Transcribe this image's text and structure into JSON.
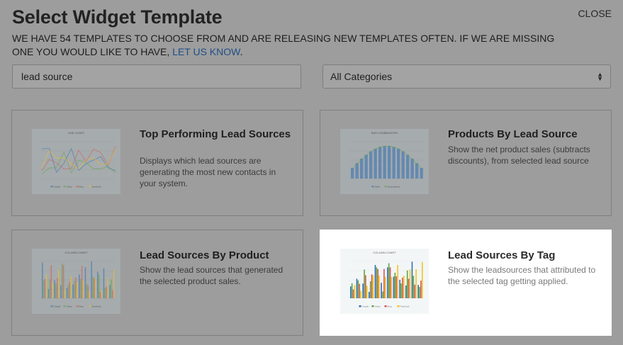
{
  "header": {
    "title": "Select Widget Template",
    "close_label": "CLOSE",
    "description_prefix": "We have 54 templates to choose from and are releasing new templates often. If we are missing one you would like to have, ",
    "link_label": "Let us know",
    "description_suffix": "."
  },
  "filters": {
    "search_value": "lead source",
    "category_selected": "All Categories"
  },
  "cards": [
    {
      "title": "Top Performing Lead Sources",
      "description": "Displays which lead sources are generating the most new contacts in your system.",
      "selected": false,
      "thumb": {
        "type": "line",
        "title": "LINE CHART",
        "legend": [
          "Google",
          "Yahoo",
          "Bing",
          "Facebook"
        ]
      }
    },
    {
      "title": "Products By Lead Source",
      "description": "Show the net product sales (subtracts discounts), from selected lead source",
      "selected": false,
      "thumb": {
        "type": "combo",
        "title": "BAR COMBINATION",
        "legend": [
          "Sales",
          "Subscriptions"
        ]
      }
    },
    {
      "title": "Lead Sources By Product",
      "description": "Show the lead sources that generated the selected product sales.",
      "selected": false,
      "thumb": {
        "type": "column",
        "title": "COLUMN CHART",
        "legend": [
          "Google",
          "Yahoo",
          "Bing",
          "Facebook"
        ]
      }
    },
    {
      "title": "Lead Sources By Tag",
      "description": "Show the leadsources that attributed to the selected tag getting applied.",
      "selected": true,
      "thumb": {
        "type": "column",
        "title": "COLUMN CHART",
        "legend": [
          "Google",
          "Yahoo",
          "Bing",
          "Facebook"
        ]
      }
    }
  ],
  "colors": {
    "overlay": "#9d9d9d",
    "selected_card": "#ffffff",
    "link": "#1f4f86",
    "series": [
      "#2e6db5",
      "#5aa63c",
      "#d9534f",
      "#f0c419"
    ]
  }
}
